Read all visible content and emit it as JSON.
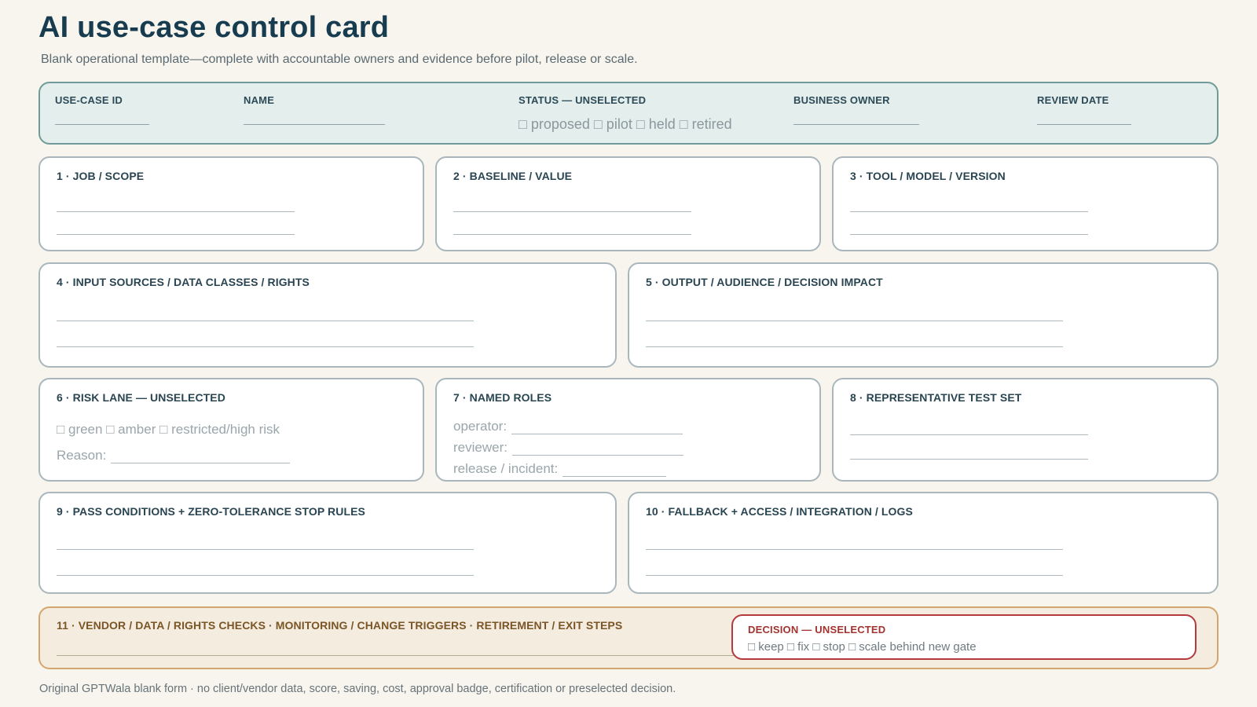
{
  "page": {
    "title": "AI use-case control card",
    "subtitle": "Blank operational template—complete with accountable owners and evidence before pilot, release or scale.",
    "footer": "Original GPTWala blank form · no client/vendor data, score, saving, cost, approval badge, certification or preselected decision."
  },
  "header": {
    "use_case_id": "USE-CASE ID",
    "name": "NAME",
    "status": "STATUS — UNSELECTED",
    "status_options": "□ proposed □ pilot □ held □ retired",
    "business_owner": "BUSINESS OWNER",
    "review_date": "REVIEW DATE"
  },
  "sections": {
    "s1": "1 · JOB / SCOPE",
    "s2": "2 · BASELINE / VALUE",
    "s3": "3 · TOOL / MODEL / VERSION",
    "s4": "4 · INPUT SOURCES / DATA CLASSES / RIGHTS",
    "s5": "5 · OUTPUT / AUDIENCE / DECISION IMPACT",
    "s6": "6 · RISK LANE — UNSELECTED",
    "s6_options": "□ green □ amber □ restricted/high risk",
    "s6_reason": "Reason:",
    "s7": "7 · NAMED ROLES",
    "s7_operator": "operator:",
    "s7_reviewer": "reviewer:",
    "s7_release": "release / incident:",
    "s8": "8 · REPRESENTATIVE TEST SET",
    "s9": "9 · PASS CONDITIONS + ZERO-TOLERANCE STOP RULES",
    "s10": "10 · FALLBACK + ACCESS / INTEGRATION / LOGS",
    "s11": "11 · VENDOR / DATA / RIGHTS CHECKS · MONITORING / CHANGE TRIGGERS · RETIREMENT / EXIT STEPS"
  },
  "decision": {
    "label": "DECISION — UNSELECTED",
    "options": "□ keep □ fix □ stop □ scale behind new gate"
  },
  "colors": {
    "background": "#f8f5ee",
    "title": "#183c4f",
    "header_fill": "#e4eeec",
    "header_border": "#6f9c98",
    "final_fill": "#f5ece0",
    "final_border": "#d4a66f",
    "decision_border": "#b43a3d"
  }
}
